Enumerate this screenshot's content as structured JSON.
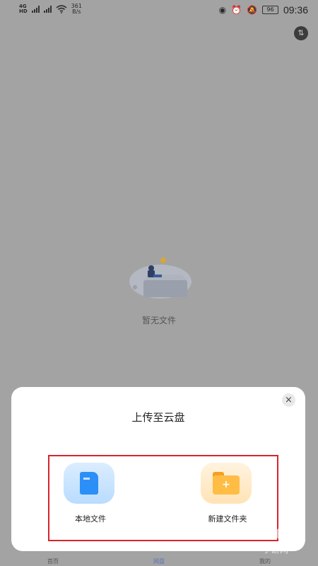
{
  "status_bar": {
    "net_speed_value": "361",
    "net_speed_unit": "B/s",
    "battery": "96",
    "time": "09:36",
    "sim1": "4G",
    "sim2": "HD",
    "icons": [
      "signal-icon",
      "wifi-icon",
      "eye-icon",
      "alarm-icon",
      "mute-icon"
    ]
  },
  "toolbar": {
    "sort_icon": "sort-arrows-icon",
    "sort_glyph": "⇅"
  },
  "empty_state": {
    "text": "暂无文件",
    "illustration": "person-on-box-illustration"
  },
  "tabs": [
    {
      "label": "首页",
      "active": false
    },
    {
      "label": "网盘",
      "active": true
    },
    {
      "label": "我的",
      "active": false
    }
  ],
  "sheet": {
    "title": "上传至云盘",
    "close_glyph": "×",
    "options": [
      {
        "label": "本地文件",
        "icon": "document-icon"
      },
      {
        "label": "新建文件夹",
        "icon": "folder-add-icon",
        "plus_glyph": "+"
      }
    ]
  },
  "watermark": {
    "text": "289com",
    "sub": "手游网"
  },
  "colors": {
    "accent_blue": "#2b8ff7",
    "folder_orange": "#ffbd45",
    "highlight_red": "#d8242e",
    "overlay_gray": "#a3a3a3"
  }
}
